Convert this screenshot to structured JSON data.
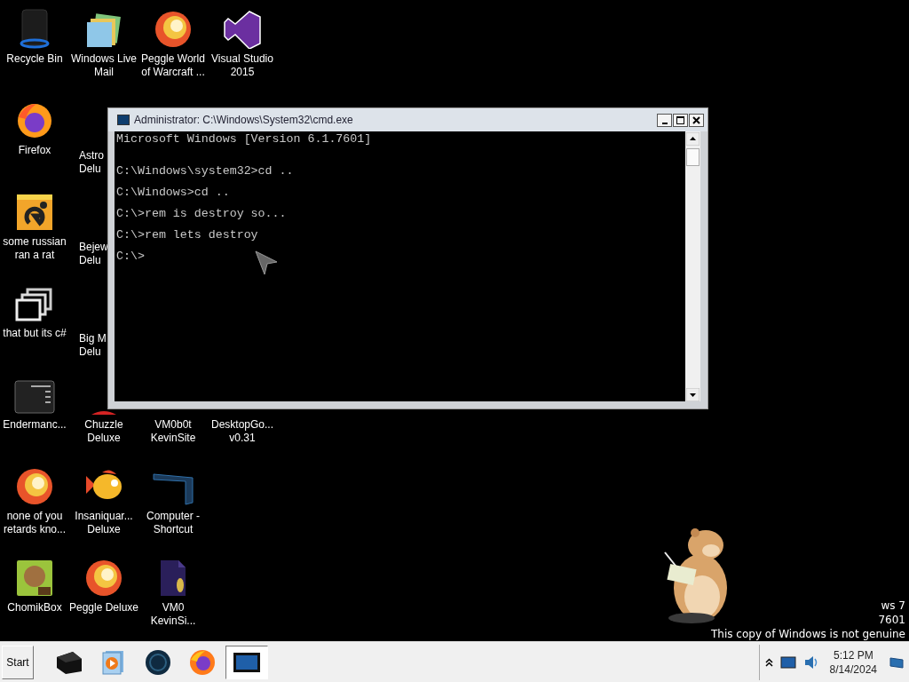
{
  "desktop": {
    "rows": [
      [
        {
          "kind": "bin",
          "label": [
            "Recycle Bin"
          ]
        },
        {
          "kind": "folders",
          "label": [
            "Windows Live",
            "Mail"
          ]
        },
        {
          "kind": "swirl",
          "label": [
            "Peggle World",
            "of Warcraft ..."
          ]
        },
        {
          "kind": "ribbon",
          "label": [
            "Visual Studio",
            "2015"
          ]
        }
      ],
      [
        {
          "kind": "fox",
          "label": [
            "Firefox"
          ]
        },
        {
          "kind": "covered",
          "label": [
            "Astro",
            "Delu"
          ]
        }
      ],
      [
        {
          "kind": "letter",
          "label": [
            "some russian",
            "ran a rat"
          ]
        },
        {
          "kind": "covered",
          "label": [
            "Bejew",
            "Delu"
          ]
        }
      ],
      [
        {
          "kind": "stack",
          "label": [
            "that but its c#"
          ]
        },
        {
          "kind": "covered",
          "label": [
            "Big M",
            "Delu"
          ]
        }
      ],
      [
        {
          "kind": "panel",
          "label": [
            "Endermanc..."
          ]
        },
        {
          "kind": "blob",
          "label": [
            "Chuzzle",
            "Deluxe"
          ]
        },
        {
          "kind": "hidden",
          "label": [
            "VM0b0t",
            "KevinSite"
          ]
        },
        {
          "kind": "hidden",
          "label": [
            "DesktopGo...",
            "v0.31"
          ]
        }
      ],
      [
        {
          "kind": "swirl",
          "label": [
            "none of you",
            "retards kno..."
          ]
        },
        {
          "kind": "fish",
          "label": [
            "Insaniquar...",
            "Deluxe"
          ]
        },
        {
          "kind": "monitor",
          "label": [
            "Computer -",
            "Shortcut"
          ]
        }
      ],
      [
        {
          "kind": "box",
          "label": [
            "ChomikBox"
          ]
        },
        {
          "kind": "swirl",
          "label": [
            "Peggle Deluxe"
          ]
        },
        {
          "kind": "doc",
          "label": [
            "VM0",
            "KevinSi..."
          ]
        }
      ]
    ]
  },
  "console_window": {
    "title": "Administrator: C:\\Windows\\System32\\cmd.exe",
    "lines": [
      {
        "kind": "banner",
        "text": "Microsoft Windows [Version 6.1.7601]"
      },
      {
        "kind": "command",
        "text": "C:\\Windows\\system32>cd .."
      },
      {
        "kind": "command",
        "text": "C:\\Windows>cd .."
      },
      {
        "kind": "command",
        "text": "C:\\>rem is destroy so..."
      },
      {
        "kind": "command",
        "text": "C:\\>rem lets destroy"
      },
      {
        "kind": "command",
        "text": "C:\\>"
      }
    ]
  },
  "watermark": {
    "lines": [
      "ws 7",
      "7601",
      "This copy of Windows is not genuine"
    ]
  },
  "taskbar": {
    "start": "Start",
    "apps": [
      {
        "kind": "box",
        "selected": false
      },
      {
        "kind": "player",
        "selected": false
      },
      {
        "kind": "globe",
        "selected": false
      },
      {
        "kind": "fox",
        "selected": false
      },
      {
        "kind": "screen",
        "selected": true
      }
    ],
    "clock": {
      "time": "5:12 PM",
      "date": "8/14/2024"
    }
  }
}
